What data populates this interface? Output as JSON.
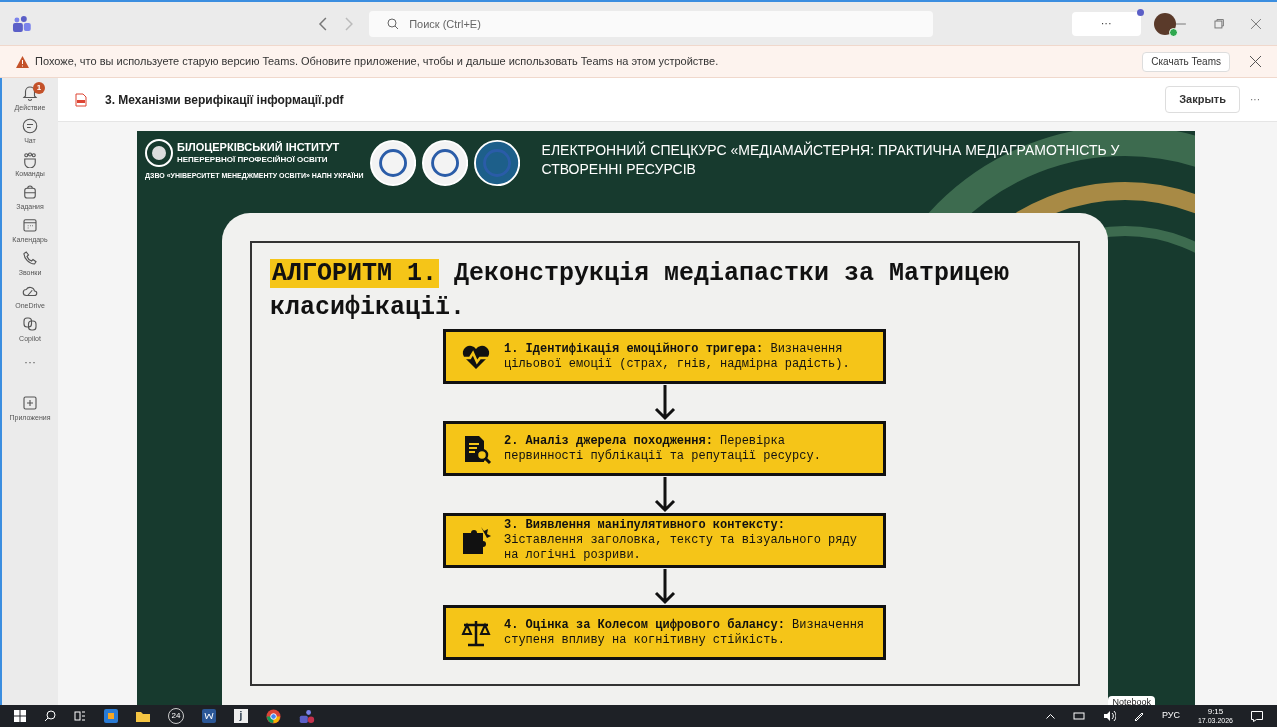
{
  "titlebar": {
    "search_placeholder": "Поиск (Ctrl+E)",
    "more": "···"
  },
  "banner": {
    "message": "Похоже, что вы используете старую версию Teams. Обновите приложение, чтобы и дальше использовать Teams на этом устройстве.",
    "button": "Скачать Teams"
  },
  "sidebar": {
    "items": [
      {
        "kind": "bell",
        "label": "Действие",
        "badge": "1"
      },
      {
        "kind": "chat",
        "label": "Чат"
      },
      {
        "kind": "teams",
        "label": "Команды"
      },
      {
        "kind": "bag",
        "label": "Задания"
      },
      {
        "kind": "calendar",
        "label": "Календарь"
      },
      {
        "kind": "phone",
        "label": "Звонки"
      },
      {
        "kind": "cloud",
        "label": "OneDrive"
      },
      {
        "kind": "copilot",
        "label": "Copilot"
      },
      {
        "kind": "more",
        "label": "···"
      },
      {
        "kind": "plus",
        "label": "Приложения"
      }
    ]
  },
  "document": {
    "title": "3. Механізми верифікації інформації.pdf",
    "close": "Закрыть",
    "more": "···"
  },
  "slide": {
    "institute": "БІЛОЦЕРКІВСЬКИЙ ІНСТИТУТ",
    "institute_sub": "НЕПЕРЕРВНОЇ ПРОФЕСІЙНОЇ ОСВІТИ",
    "institute_parent": "ДЗВО «УНІВЕРСИТЕТ МЕНЕДЖМЕНТУ ОСВІТИ» НАПН УКРАЇНИ",
    "course_title": "ЕЛЕКТРОННИЙ СПЕЦКУРС «МЕДІАМАЙСТЕРНЯ: ПРАКТИЧНА МЕДІАГРАМОТНІСТЬ У СТВОРЕННІ РЕСУРСІВ",
    "title_highlight": "АЛГОРИТМ 1.",
    "title_text": "Деконструкція медіапастки за Матрицею класифікації.",
    "steps": [
      {
        "kind": "heart",
        "text": "**1. Ідентифікація емоційного тригера:** Визначення цільової емоції (страх, гнів, надмірна радість)."
      },
      {
        "kind": "document",
        "text": "**2. Аналіз джерела походження:** Перевірка первинності публікації та репутації ресурсу."
      },
      {
        "kind": "puzzle",
        "text": "**3. Виявлення маніпулятивного контексту:** Зіставлення заголовка, тексту та візуального ряду на логічні розриви."
      },
      {
        "kind": "scales",
        "text": "**4. Оцінка за Колесом цифрового балансу:** Визначення ступеня впливу на когнітивну стійкість."
      }
    ],
    "watermark_label": "Notebook"
  },
  "taskbar": {
    "badge": "24",
    "letter_app": "j",
    "language": "РУС",
    "time": "9:15",
    "date": "17.03.2026"
  }
}
